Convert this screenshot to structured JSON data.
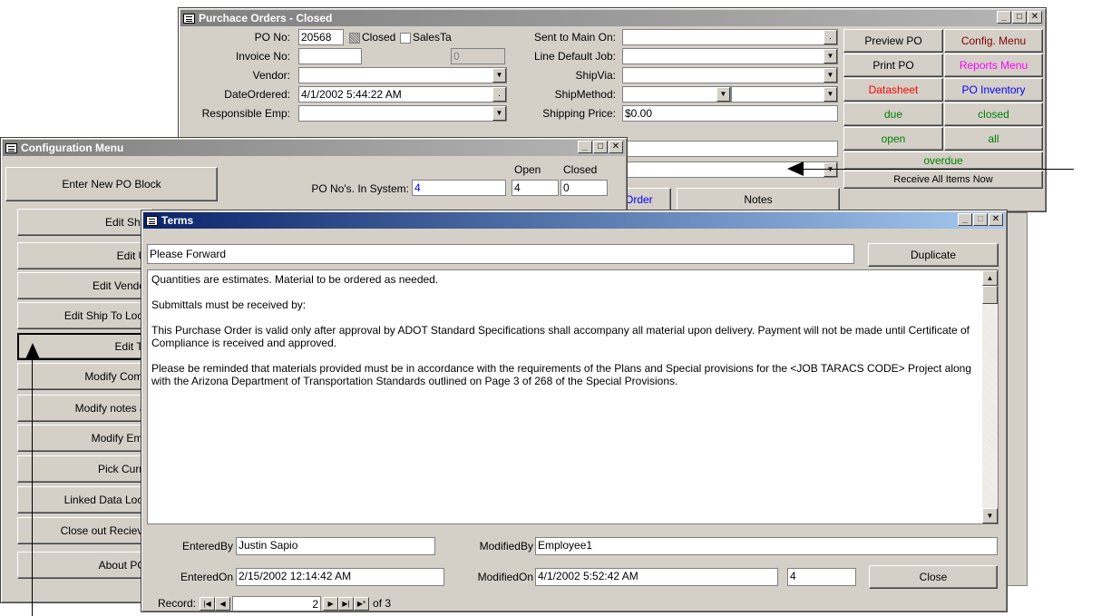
{
  "po_window": {
    "title": "Purchace Orders - Closed",
    "labels": {
      "po_no": "PO No:",
      "invoice_no": "Invoice No:",
      "vendor": "Vendor:",
      "date_ordered": "DateOrdered:",
      "responsible_emp": "Responsible Emp:",
      "sent_to_main_on": "Sent to Main On:",
      "line_default_job": "Line Default Job:",
      "ship_via": "ShipVia:",
      "ship_method": "ShipMethod:",
      "shipping_price": "Shipping Price:"
    },
    "values": {
      "po_no": "20568",
      "invoice_no": "",
      "vendor": "",
      "date_ordered": "4/1/2002 5:44:22 AM",
      "responsible_emp": "",
      "sales_tax_field": "0",
      "sent_to_main_on": "",
      "line_default_job": "",
      "ship_via": "",
      "ship_method": "",
      "shipping_price": "$0.00"
    },
    "closed_label": "Closed",
    "sales_tax_label": "SalesTa",
    "buttons": {
      "preview_po": "Preview PO",
      "config_menu": "Config. Menu",
      "print_po": "Print PO",
      "reports_menu": "Reports Menu",
      "datasheet": "Datasheet",
      "po_inventory": "PO Inventory",
      "due": "due",
      "closed": "closed",
      "open": "open",
      "all": "all",
      "overdue": "overdue",
      "receive_all": "Receive All Items Now",
      "order_tab": "Order",
      "notes_tab": "Notes"
    },
    "colors": {
      "config_menu": "#800000",
      "reports_menu": "#ff00ff",
      "datasheet": "#ff0000",
      "po_inventory": "#0000ff",
      "green": "#008000",
      "title_inactive": "#808080"
    }
  },
  "config_window": {
    "title": "Configuration Menu",
    "po_no_in_system_label": "PO No's. In System:",
    "po_no_in_system_value": "4",
    "open_label": "Open",
    "closed_label": "Closed",
    "open_value": "4",
    "closed_value": "0",
    "buttons": [
      "Enter New PO Block",
      "Edit Ship",
      "Edit Ui",
      "Edit Vendor",
      "Edit Ship To Loca",
      "Edit Te",
      "Modify Comp",
      "Modify notes at",
      "Modify Emp",
      "Pick Curre",
      "Linked Data Loca",
      "Close out Recieve",
      "About PO:"
    ]
  },
  "terms_window": {
    "title": "Terms",
    "term_name": "Please Forward",
    "duplicate_button": "Duplicate",
    "body_paragraphs": [
      "Quantities are estimates. Material to be ordered as needed.",
      "Submittals must be received by:",
      "This Purchase Order is valid only after approval by ADOT Standard Specifications shall accompany all material upon delivery. Payment will not be made until Certificate of Compliance is received and approved.",
      "Please be reminded that materials provided must be in accordance with the requirements of the Plans and Special provisions for the <JOB TARACS CODE> Project along with the Arizona Department of Transportation Standards outlined on Page 3 of 268 of the Special Provisions."
    ],
    "entered_by_label": "EnteredBy",
    "entered_by": "Justin Sapio",
    "modified_by_label": "ModifiedBy",
    "modified_by": "Employee1",
    "entered_on_label": "EnteredOn",
    "entered_on": "2/15/2002 12:14:42 AM",
    "modified_on_label": "ModifiedOn",
    "modified_on": "4/1/2002 5:52:42 AM",
    "id_value": "4",
    "close_button": "Close",
    "record_label": "Record:",
    "record_current": "2",
    "record_of": "of 3"
  },
  "icons": [
    "form-icon",
    "minimize-icon",
    "maximize-icon",
    "close-icon",
    "dropdown-arrow-icon",
    "scroll-up-icon",
    "scroll-down-icon",
    "first-record-icon",
    "prev-record-icon",
    "next-record-icon",
    "last-record-icon",
    "new-record-icon",
    "annotation-arrow-icon"
  ]
}
